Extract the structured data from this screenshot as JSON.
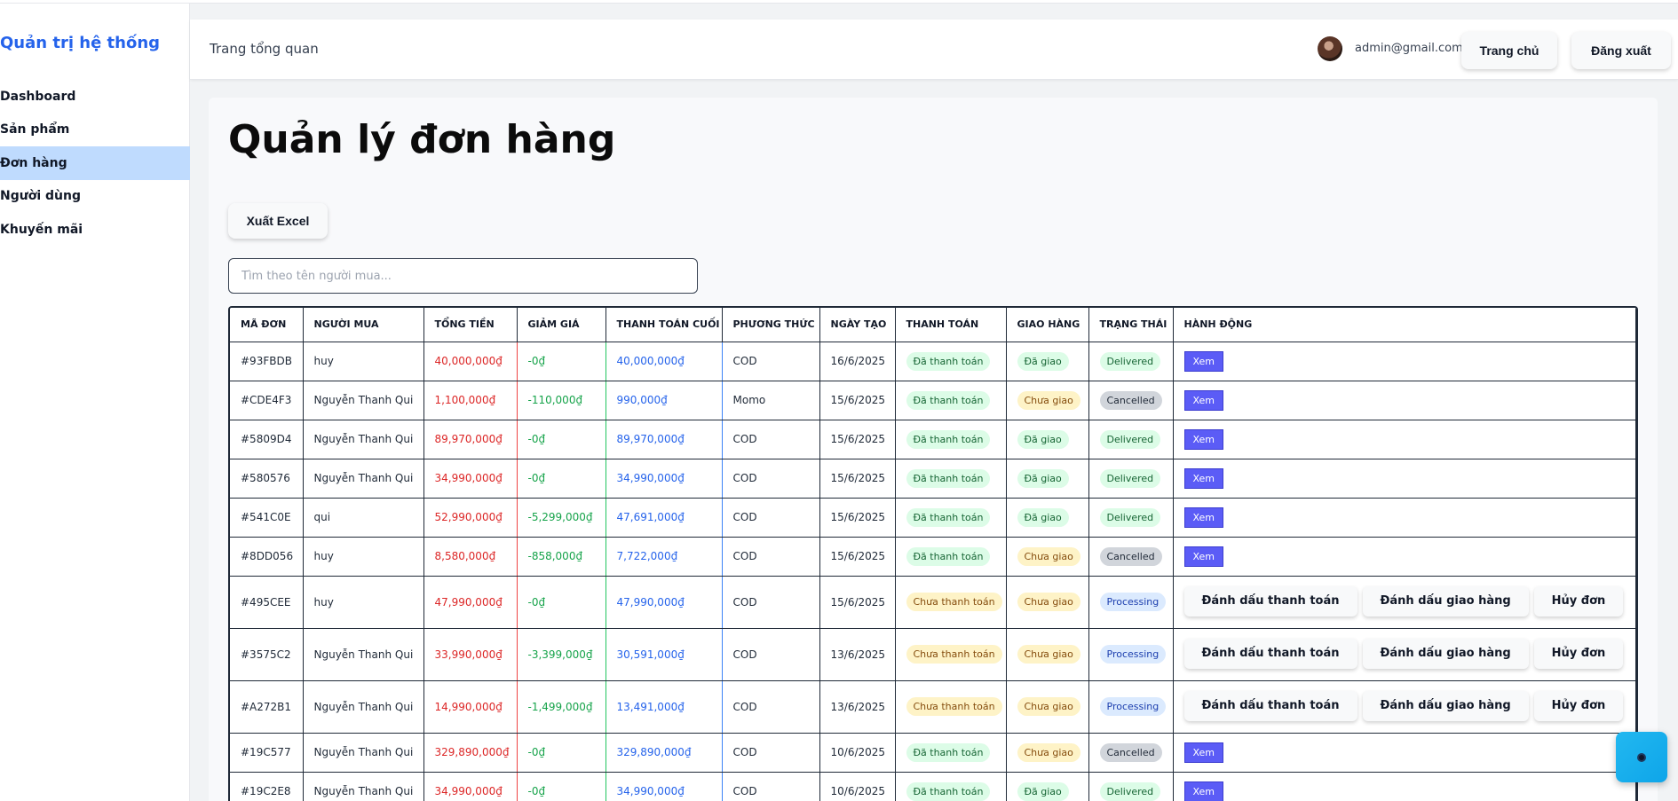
{
  "sidebar": {
    "brand": "Quản trị hệ thống",
    "items": [
      {
        "label": "Dashboard",
        "active": false
      },
      {
        "label": "Sản phẩm",
        "active": false
      },
      {
        "label": "Đơn hàng",
        "active": true
      },
      {
        "label": "Người dùng",
        "active": false
      },
      {
        "label": "Khuyến mãi",
        "active": false
      }
    ]
  },
  "header": {
    "title": "Trang tổng quan",
    "email": "admin@gmail.com",
    "home_label": "Trang chủ",
    "logout_label": "Đăng xuất"
  },
  "main": {
    "title": "Quản lý đơn hàng",
    "export_label": "Xuất Excel",
    "search_placeholder": "Tìm theo tên người mua..."
  },
  "table": {
    "columns": [
      "MÃ ĐƠN",
      "NGƯỜI MUA",
      "TỔNG TIỀN",
      "GIẢM GIÁ",
      "THANH TOÁN CUỐI",
      "PHƯƠNG THỨC",
      "NGÀY TẠO",
      "THANH TOÁN",
      "GIAO HÀNG",
      "TRẠNG THÁI",
      "HÀNH ĐỘNG"
    ],
    "action_labels": {
      "view": "Xem",
      "mark_paid": "Đánh dấu thanh toán",
      "mark_shipped": "Đánh dấu giao hàng",
      "cancel": "Hủy đơn"
    },
    "rows": [
      {
        "id": "#93FBDB",
        "buyer": "huy",
        "total": "40,000,000₫",
        "discount": "-0₫",
        "final": "40,000,000₫",
        "method": "COD",
        "date": "16/6/2025",
        "payment": "Đã thanh toán",
        "shipping": "Đã giao",
        "status": "Delivered",
        "full_actions": false
      },
      {
        "id": "#CDE4F3",
        "buyer": "Nguyễn Thanh Qui",
        "total": "1,100,000₫",
        "discount": "-110,000₫",
        "final": "990,000₫",
        "method": "Momo",
        "date": "15/6/2025",
        "payment": "Đã thanh toán",
        "shipping": "Chưa giao",
        "status": "Cancelled",
        "full_actions": false
      },
      {
        "id": "#5809D4",
        "buyer": "Nguyễn Thanh Qui",
        "total": "89,970,000₫",
        "discount": "-0₫",
        "final": "89,970,000₫",
        "method": "COD",
        "date": "15/6/2025",
        "payment": "Đã thanh toán",
        "shipping": "Đã giao",
        "status": "Delivered",
        "full_actions": false
      },
      {
        "id": "#580576",
        "buyer": "Nguyễn Thanh Qui",
        "total": "34,990,000₫",
        "discount": "-0₫",
        "final": "34,990,000₫",
        "method": "COD",
        "date": "15/6/2025",
        "payment": "Đã thanh toán",
        "shipping": "Đã giao",
        "status": "Delivered",
        "full_actions": false
      },
      {
        "id": "#541C0E",
        "buyer": "qui",
        "total": "52,990,000₫",
        "discount": "-5,299,000₫",
        "final": "47,691,000₫",
        "method": "COD",
        "date": "15/6/2025",
        "payment": "Đã thanh toán",
        "shipping": "Đã giao",
        "status": "Delivered",
        "full_actions": false
      },
      {
        "id": "#8DD056",
        "buyer": "huy",
        "total": "8,580,000₫",
        "discount": "-858,000₫",
        "final": "7,722,000₫",
        "method": "COD",
        "date": "15/6/2025",
        "payment": "Đã thanh toán",
        "shipping": "Chưa giao",
        "status": "Cancelled",
        "full_actions": false
      },
      {
        "id": "#495CEE",
        "buyer": "huy",
        "total": "47,990,000₫",
        "discount": "-0₫",
        "final": "47,990,000₫",
        "method": "COD",
        "date": "15/6/2025",
        "payment": "Chưa thanh toán",
        "shipping": "Chưa giao",
        "status": "Processing",
        "full_actions": true
      },
      {
        "id": "#3575C2",
        "buyer": "Nguyễn Thanh Qui",
        "total": "33,990,000₫",
        "discount": "-3,399,000₫",
        "final": "30,591,000₫",
        "method": "COD",
        "date": "13/6/2025",
        "payment": "Chưa thanh toán",
        "shipping": "Chưa giao",
        "status": "Processing",
        "full_actions": true
      },
      {
        "id": "#A272B1",
        "buyer": "Nguyễn Thanh Qui",
        "total": "14,990,000₫",
        "discount": "-1,499,000₫",
        "final": "13,491,000₫",
        "method": "COD",
        "date": "13/6/2025",
        "payment": "Chưa thanh toán",
        "shipping": "Chưa giao",
        "status": "Processing",
        "full_actions": true
      },
      {
        "id": "#19C577",
        "buyer": "Nguyễn Thanh Qui",
        "total": "329,890,000₫",
        "discount": "-0₫",
        "final": "329,890,000₫",
        "method": "COD",
        "date": "10/6/2025",
        "payment": "Đã thanh toán",
        "shipping": "Chưa giao",
        "status": "Cancelled",
        "full_actions": false
      },
      {
        "id": "#19C2E8",
        "buyer": "Nguyễn Thanh Qui",
        "total": "34,990,000₫",
        "discount": "-0₫",
        "final": "34,990,000₫",
        "method": "COD",
        "date": "10/6/2025",
        "payment": "Đã thanh toán",
        "shipping": "Đã giao",
        "status": "Delivered",
        "full_actions": false
      }
    ]
  },
  "colors": {
    "brand": "#2563eb",
    "active_nav": "#bfdbfe",
    "view_button": "#5b5cf6",
    "total": "#dc2626",
    "discount": "#16a34a",
    "final": "#2563eb"
  },
  "icons": {
    "chat": "chat-bubble-icon",
    "avatar": "user-avatar"
  }
}
